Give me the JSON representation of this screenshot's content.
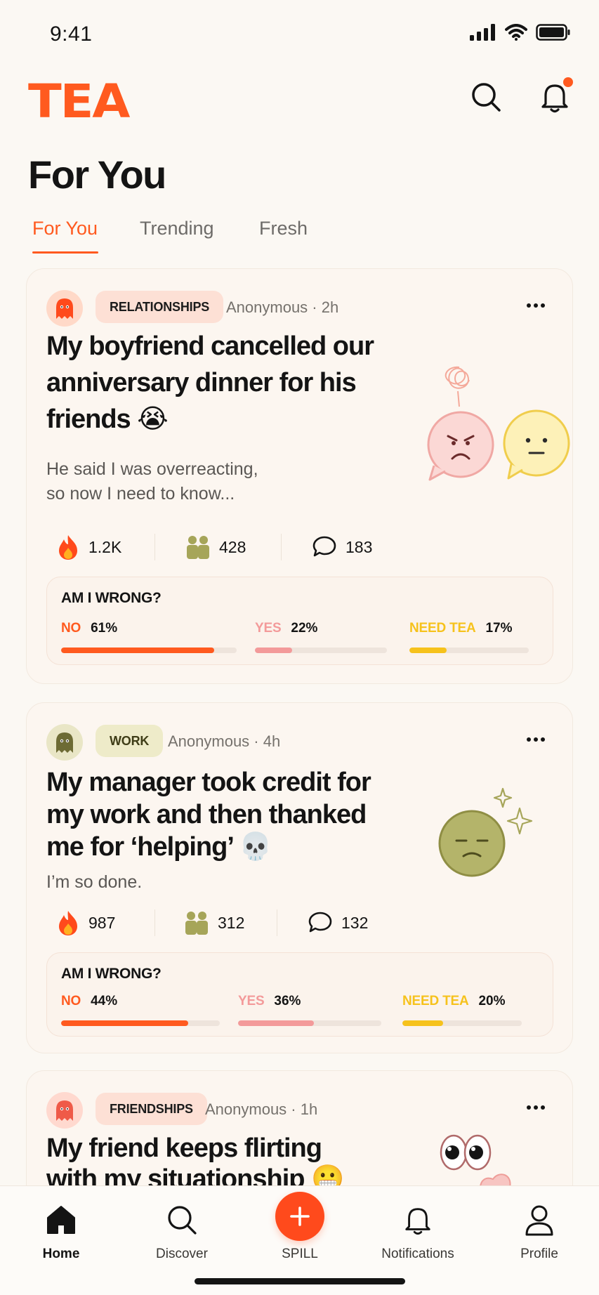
{
  "status_bar": {
    "time": "9:41"
  },
  "header": {
    "logo": "TEA",
    "search_icon": "search-icon",
    "bell_icon": "bell-icon",
    "has_notification": true
  },
  "page": {
    "title": "For You"
  },
  "tabs": [
    {
      "label": "For You",
      "active": true
    },
    {
      "label": "Trending",
      "active": false
    },
    {
      "label": "Fresh",
      "active": false
    }
  ],
  "colors": {
    "accent": "#ff5a1f",
    "yes": "#f39a9a",
    "need_tea": "#f6c21c",
    "work": "#a6a559"
  },
  "posts": [
    {
      "category": "RELATIONSHIPS",
      "author": "Anonymous · 2h",
      "title_lines": [
        "My boyfriend cancelled our",
        "anniversary dinner for his",
        "friends 😭"
      ],
      "body_lines": [
        "He said I was overreacting,",
        "so now I need to know..."
      ],
      "stats": {
        "fire": "1.2K",
        "people": "428",
        "comments": "183"
      },
      "poll": {
        "title": "AM I WRONG?",
        "options": [
          {
            "label": "NO",
            "pct": "61%",
            "value": 0.61
          },
          {
            "label": "YES",
            "pct": "22%",
            "value": 0.22
          },
          {
            "label": "NEED TEA",
            "pct": "17%",
            "value": 0.17
          }
        ]
      }
    },
    {
      "category": "WORK",
      "author": "Anonymous · 4h",
      "title_lines": [
        "My manager took credit for",
        "my work and then thanked",
        "me for ‘helping’ 💀"
      ],
      "body_lines": [
        "I’m so done."
      ],
      "stats": {
        "fire": "987",
        "people": "312",
        "comments": "132"
      },
      "poll": {
        "title": "AM I WRONG?",
        "options": [
          {
            "label": "NO",
            "pct": "44%",
            "value": 0.44
          },
          {
            "label": "YES",
            "pct": "36%",
            "value": 0.36
          },
          {
            "label": "NEED TEA",
            "pct": "20%",
            "value": 0.2
          }
        ]
      }
    },
    {
      "category": "FRIENDSHIPS",
      "author": "Anonymous · 1h",
      "title_lines": [
        "My friend keeps flirting",
        "with my situationship 😬"
      ]
    }
  ],
  "bottom_nav": [
    {
      "label": "Home",
      "icon": "home-icon",
      "active": true
    },
    {
      "label": "Discover",
      "icon": "search-icon",
      "active": false
    },
    {
      "label": "SPILL",
      "icon": "plus-icon",
      "active": false
    },
    {
      "label": "Notifications",
      "icon": "bell-icon",
      "active": false
    },
    {
      "label": "Profile",
      "icon": "person-icon",
      "active": false
    }
  ]
}
